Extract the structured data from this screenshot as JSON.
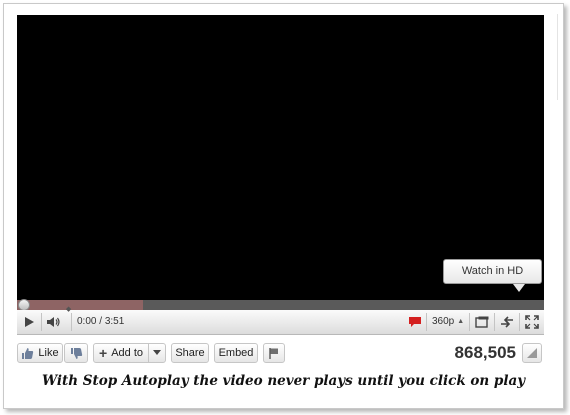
{
  "player": {
    "tooltip": "Watch in HD",
    "time_current": "0:00",
    "time_separator": " / ",
    "time_total": "3:51",
    "quality": "360p",
    "loaded_fraction": 0.24
  },
  "actions": {
    "like_label": "Like",
    "add_to_label": "Add to",
    "share_label": "Share",
    "embed_label": "Embed"
  },
  "view_count": "868,505",
  "caption": "With Stop Autoplay the video never plays until you click on play",
  "colors": {
    "video_bg": "#000000",
    "progress_loaded": "#8e6464",
    "annotation_red": "#d42020"
  }
}
